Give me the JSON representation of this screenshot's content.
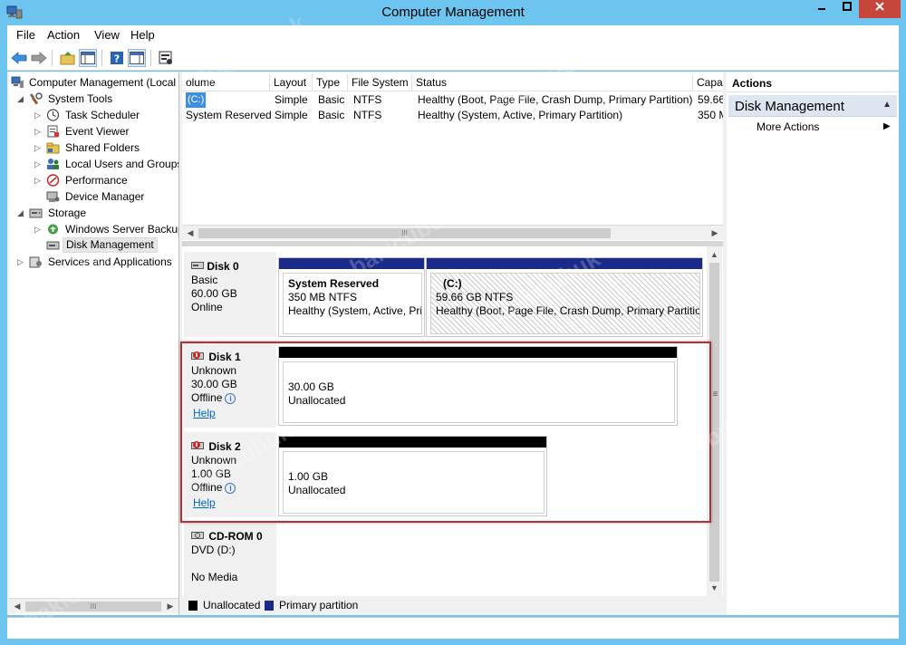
{
  "window": {
    "title": "Computer Management"
  },
  "menubar": {
    "items": [
      "File",
      "Action",
      "View",
      "Help"
    ]
  },
  "tree": {
    "items": [
      {
        "label": "Computer Management (Local",
        "icon": "computer-management-icon",
        "expander": ""
      },
      {
        "label": "System Tools",
        "icon": "system-tools-icon",
        "expander": "◢"
      },
      {
        "label": "Task Scheduler",
        "icon": "clock-icon",
        "expander": "▷"
      },
      {
        "label": "Event Viewer",
        "icon": "event-viewer-icon",
        "expander": "▷"
      },
      {
        "label": "Shared Folders",
        "icon": "shared-folder-icon",
        "expander": "▷"
      },
      {
        "label": "Local Users and Groups",
        "icon": "users-icon",
        "expander": "▷"
      },
      {
        "label": "Performance",
        "icon": "performance-icon",
        "expander": "▷"
      },
      {
        "label": "Device Manager",
        "icon": "device-manager-icon",
        "expander": ""
      },
      {
        "label": "Storage",
        "icon": "storage-icon",
        "expander": "◢"
      },
      {
        "label": "Windows Server Backup",
        "icon": "backup-icon",
        "expander": "▷"
      },
      {
        "label": "Disk Management",
        "icon": "disk-management-icon",
        "expander": ""
      },
      {
        "label": "Services and Applications",
        "icon": "services-icon",
        "expander": "▷"
      }
    ],
    "scroll_label": "III"
  },
  "volume_list": {
    "columns": [
      "olume",
      "Layout",
      "Type",
      "File System",
      "Status",
      "Capa"
    ],
    "rows": [
      {
        "volume": "(C:)",
        "layout": "Simple",
        "type": "Basic",
        "fs": "NTFS",
        "status": "Healthy (Boot, Page File, Crash Dump, Primary Partition)",
        "capacity": "59.66"
      },
      {
        "volume": "System Reserved",
        "layout": "Simple",
        "type": "Basic",
        "fs": "NTFS",
        "status": "Healthy (System, Active, Primary Partition)",
        "capacity": "350 M"
      }
    ],
    "scroll_label": "III"
  },
  "disks": [
    {
      "name": "Disk 0",
      "type": "Basic",
      "size": "60.00 GB",
      "state": "Online",
      "help": "",
      "partitions": [
        {
          "title": "System Reserved",
          "size": "350 MB NTFS",
          "status": "Healthy (System, Active, Pri"
        },
        {
          "title": "(C:)",
          "size": "59.66 GB NTFS",
          "status": "Healthy (Boot, Page File, Crash Dump, Primary Partition"
        }
      ]
    },
    {
      "name": "Disk 1",
      "type": "Unknown",
      "size": "30.00 GB",
      "state": "Offline",
      "help": "Help",
      "partitions": [
        {
          "title": "",
          "size": "30.00 GB",
          "status": "Unallocated"
        }
      ]
    },
    {
      "name": "Disk 2",
      "type": "Unknown",
      "size": "1.00 GB",
      "state": "Offline",
      "help": "Help",
      "partitions": [
        {
          "title": "",
          "size": "1.00 GB",
          "status": "Unallocated"
        }
      ]
    },
    {
      "name": "CD-ROM 0",
      "type": "DVD (D:)",
      "size": "",
      "state": "No Media",
      "help": "",
      "partitions": []
    }
  ],
  "legend": {
    "unallocated": "Unallocated",
    "primary": "Primary partition"
  },
  "actions": {
    "header": "Actions",
    "group": "Disk Management",
    "item": "More Actions"
  },
  "watermark": "bakicubuk",
  "colors": {
    "titlebar": "#6dc5ef",
    "primary_partition": "#1a2a8a",
    "unallocated": "#000000",
    "highlight": "#b33034",
    "close_button": "#c7463c"
  }
}
